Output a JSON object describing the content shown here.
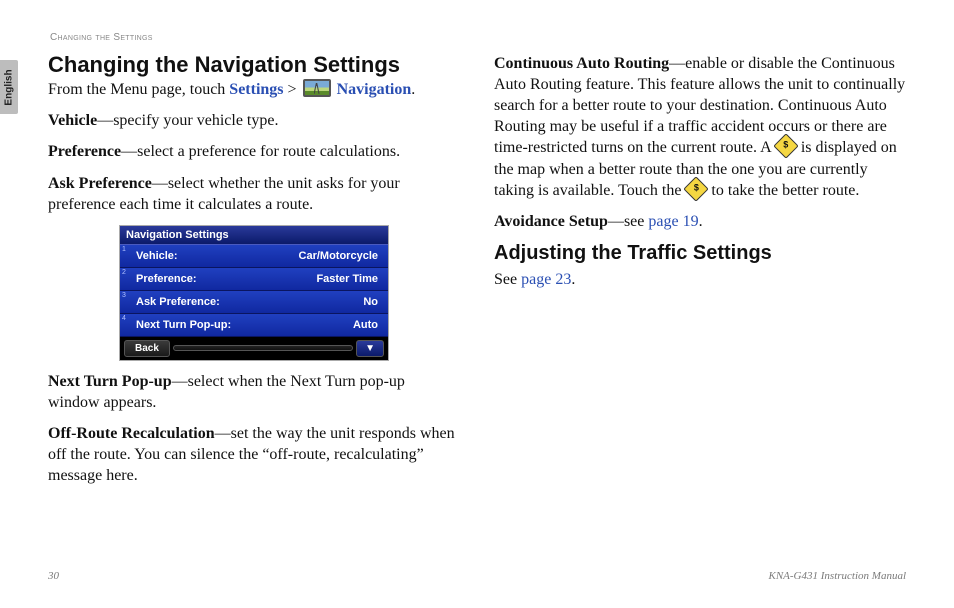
{
  "language_tab": "English",
  "running_head": "Changing the Settings",
  "left": {
    "h1": "Changing the Navigation Settings",
    "intro_prefix": "From the Menu page, touch ",
    "settings_link": "Settings",
    "breadcrumb_sep": " > ",
    "nav_link": " Navigation",
    "period": ".",
    "vehicle_b": "Vehicle",
    "vehicle_t": "—specify your vehicle type.",
    "pref_b": "Preference",
    "pref_t": "—select a preference for route calculations.",
    "ask_b": "Ask Preference",
    "ask_t": "—select whether the unit asks for your preference each time it calculates a route.",
    "next_b": "Next Turn Pop-up",
    "next_t": "—select when the Next Turn pop-up window appears.",
    "off_b": "Off-Route Recalculation",
    "off_t": "—set the way the unit responds when off the route. You can silence the “off-route, recalculating” message here."
  },
  "screenshot": {
    "title": "Navigation Settings",
    "rows": [
      {
        "n": "1",
        "label": "Vehicle:",
        "value": "Car/Motorcycle"
      },
      {
        "n": "2",
        "label": "Preference:",
        "value": "Faster Time"
      },
      {
        "n": "3",
        "label": "Ask Preference:",
        "value": "No"
      },
      {
        "n": "4",
        "label": "Next Turn Pop-up:",
        "value": "Auto"
      }
    ],
    "back": "Back",
    "down": "▼"
  },
  "right": {
    "car_b": "Continuous Auto Routing",
    "car_t1": "—enable or disable the Continuous Auto Routing feature. This feature allows the unit to continually search for a better route to your destination. Continuous Auto Routing may be useful if a traffic accident occurs or there are time-restricted turns on the current route. A ",
    "car_t2": " is displayed on the map when a better route than the one you are currently taking is available. Touch the ",
    "car_t3": " to take the better route.",
    "avoid_b": "Avoidance Setup",
    "avoid_t": "—see ",
    "avoid_link": "page 19",
    "h2": "Adjusting the Traffic Settings",
    "see": "See ",
    "traffic_link": "page 23"
  },
  "footer": {
    "page": "30",
    "manual": "KNA-G431 Instruction Manual"
  }
}
